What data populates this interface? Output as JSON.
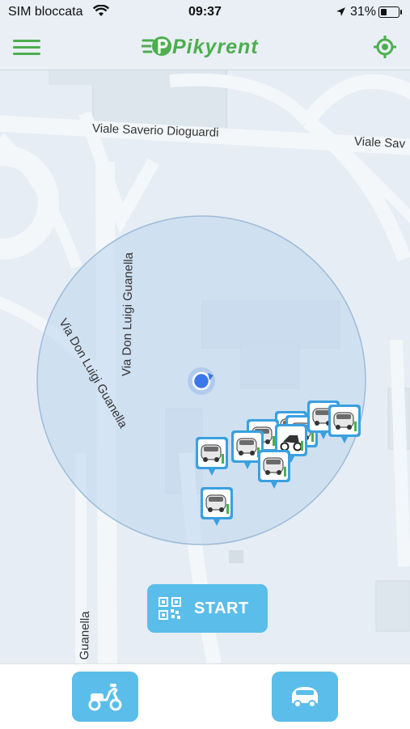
{
  "status_bar": {
    "carrier": "SIM bloccata",
    "time": "09:37",
    "battery": "31%",
    "battery_level": 0.31,
    "icons": [
      "wifi-icon",
      "location-arrow-icon",
      "battery-icon"
    ]
  },
  "header": {
    "app_name": "Pikyrent",
    "icons": [
      "menu-icon",
      "locate-me-icon"
    ],
    "accent": "#4cae4f"
  },
  "map": {
    "streets": [
      "Viale Saverio Dioguardi",
      "Viale Sav",
      "Via Don Luigi Guanella",
      "Via Don Luigi Guanella",
      "Via Don Luigi Guanella",
      "Guanella"
    ],
    "vehicle_markers": [
      "car",
      "car",
      "car",
      "car",
      "car",
      "scooter",
      "car",
      "car",
      "car",
      "car"
    ],
    "colors": {
      "marker": "#3aa0e0",
      "user_dot": "#3b78e7",
      "radius_fill": "#bcd6ee"
    }
  },
  "start_button": {
    "label": "START",
    "icon": "qr-code-icon",
    "color": "#5bbde9"
  },
  "bottom_bar": {
    "buttons": [
      {
        "name": "scooter",
        "icon": "scooter-icon"
      },
      {
        "name": "car",
        "icon": "car-icon"
      }
    ]
  }
}
